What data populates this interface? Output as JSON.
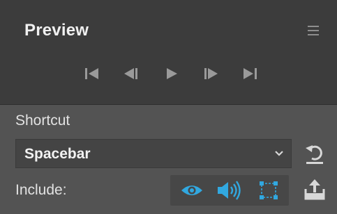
{
  "panel": {
    "title": "Preview",
    "menu_icon": "hamburger-menu-icon"
  },
  "transport": {
    "buttons": [
      {
        "name": "first-frame",
        "icon": "skip-to-start-icon"
      },
      {
        "name": "step-back",
        "icon": "step-backward-icon"
      },
      {
        "name": "play",
        "icon": "play-icon"
      },
      {
        "name": "step-forward",
        "icon": "step-forward-icon"
      },
      {
        "name": "last-frame",
        "icon": "skip-to-end-icon"
      }
    ]
  },
  "shortcut": {
    "label": "Shortcut",
    "value": "Spacebar",
    "dropdown_icon": "chevron-down-icon",
    "reset_icon": "reset-icon"
  },
  "include": {
    "label": "Include:",
    "toggles": [
      {
        "name": "visibility",
        "icon": "eye-icon",
        "active": true
      },
      {
        "name": "audio",
        "icon": "speaker-icon",
        "active": true
      },
      {
        "name": "bounds",
        "icon": "selection-box-icon",
        "active": true
      }
    ],
    "export_icon": "export-icon"
  },
  "colors": {
    "header_bg": "#3c3c3c",
    "panel_bg": "#535353",
    "accent": "#31a8e0",
    "icon_gray": "#9a9a9a"
  }
}
